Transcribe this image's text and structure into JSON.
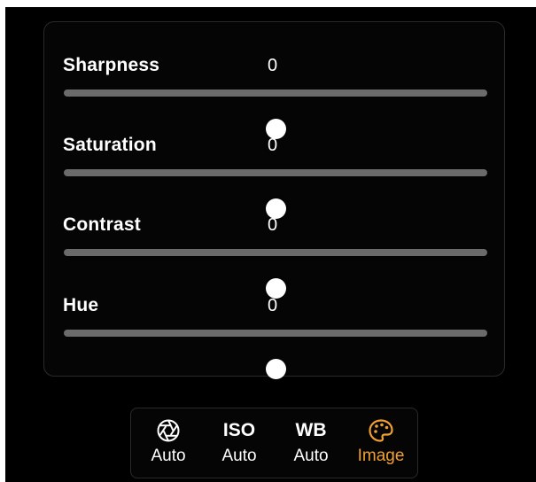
{
  "sliders": [
    {
      "label": "Sharpness",
      "value": "0",
      "level": 0.5
    },
    {
      "label": "Saturation",
      "value": "0",
      "level": 0.5
    },
    {
      "label": "Contrast",
      "value": "0",
      "level": 0.5
    },
    {
      "label": "Hue",
      "value": "0",
      "level": 0.5
    }
  ],
  "toolbar": {
    "items": [
      {
        "icon": "aperture-icon",
        "icon_text": "",
        "label": "Auto",
        "active": false
      },
      {
        "icon": "iso-icon",
        "icon_text": "ISO",
        "label": "Auto",
        "active": false
      },
      {
        "icon": "wb-icon",
        "icon_text": "WB",
        "label": "Auto",
        "active": false
      },
      {
        "icon": "palette-icon",
        "icon_text": "",
        "label": "Image",
        "active": true
      }
    ]
  },
  "colors": {
    "accent": "#f0a030",
    "track": "#6b6b6b",
    "background": "#000000"
  }
}
